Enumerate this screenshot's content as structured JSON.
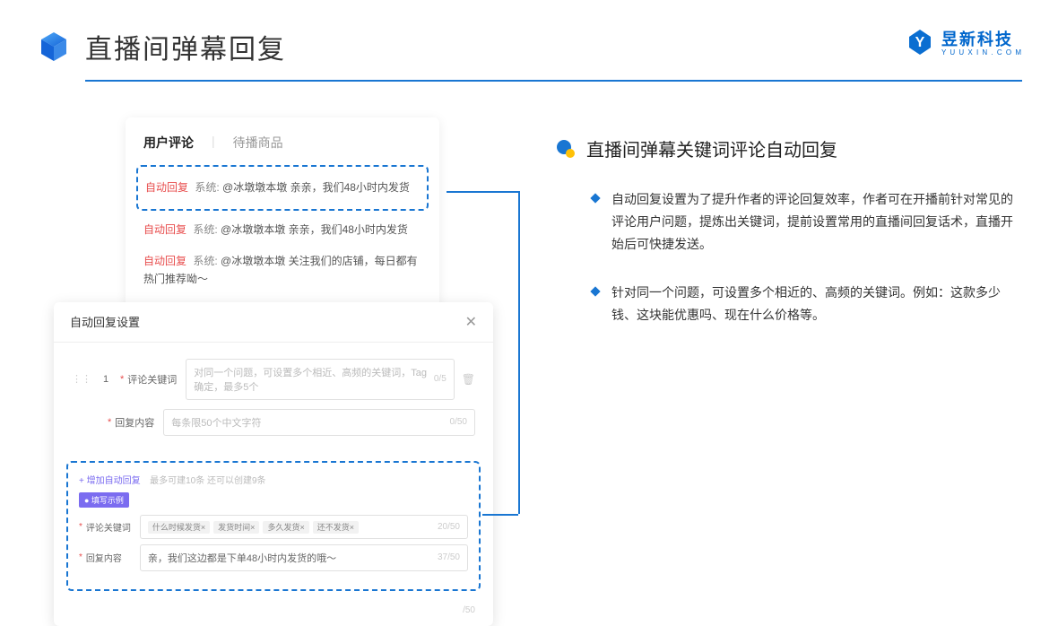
{
  "header": {
    "title": "直播间弹幕回复"
  },
  "brand": {
    "name": "昱新科技",
    "sub": "Y U U X I N . C O M"
  },
  "commentPanel": {
    "tab1": "用户评论",
    "tab2": "待播商品",
    "c1_badge": "自动回复",
    "c1_sys": "系统:",
    "c1_text": "@冰墩墩本墩 亲亲，我们48小时内发货",
    "c2_badge": "自动回复",
    "c2_sys": "系统:",
    "c2_text": "@冰墩墩本墩 亲亲，我们48小时内发货",
    "c3_badge": "自动回复",
    "c3_sys": "系统:",
    "c3_text": "@冰墩墩本墩 关注我们的店铺，每日都有热门推荐呦～"
  },
  "settings": {
    "title": "自动回复设置",
    "num": "1",
    "kw_label": "评论关键词",
    "kw_placeholder": "对同一个问题，可设置多个相近、高频的关键词，Tag确定，最多5个",
    "kw_count": "0/5",
    "reply_label": "回复内容",
    "reply_placeholder": "每条限50个中文字符",
    "reply_count": "0/50",
    "add": "+ 增加自动回复",
    "add_hint": "最多可建10条 还可以创建9条",
    "ex_badge": "● 填写示例",
    "ex_kw_label": "评论关键词",
    "ex_tags": [
      "什么时候发货×",
      "发货时间×",
      "多久发货×",
      "还不发货×"
    ],
    "ex_kw_count": "20/50",
    "ex_reply_label": "回复内容",
    "ex_reply_text": "亲，我们这边都是下单48小时内发货的哦～",
    "ex_reply_count": "37/50",
    "outer_count": "/50"
  },
  "right": {
    "sectionTitle": "直播间弹幕关键词评论自动回复",
    "b1": "自动回复设置为了提升作者的评论回复效率，作者可在开播前针对常见的评论用户问题，提炼出关键词，提前设置常用的直播间回复话术，直播开始后可快捷发送。",
    "b2": "针对同一个问题，可设置多个相近的、高频的关键词。例如：这款多少钱、这块能优惠吗、现在什么价格等。"
  }
}
